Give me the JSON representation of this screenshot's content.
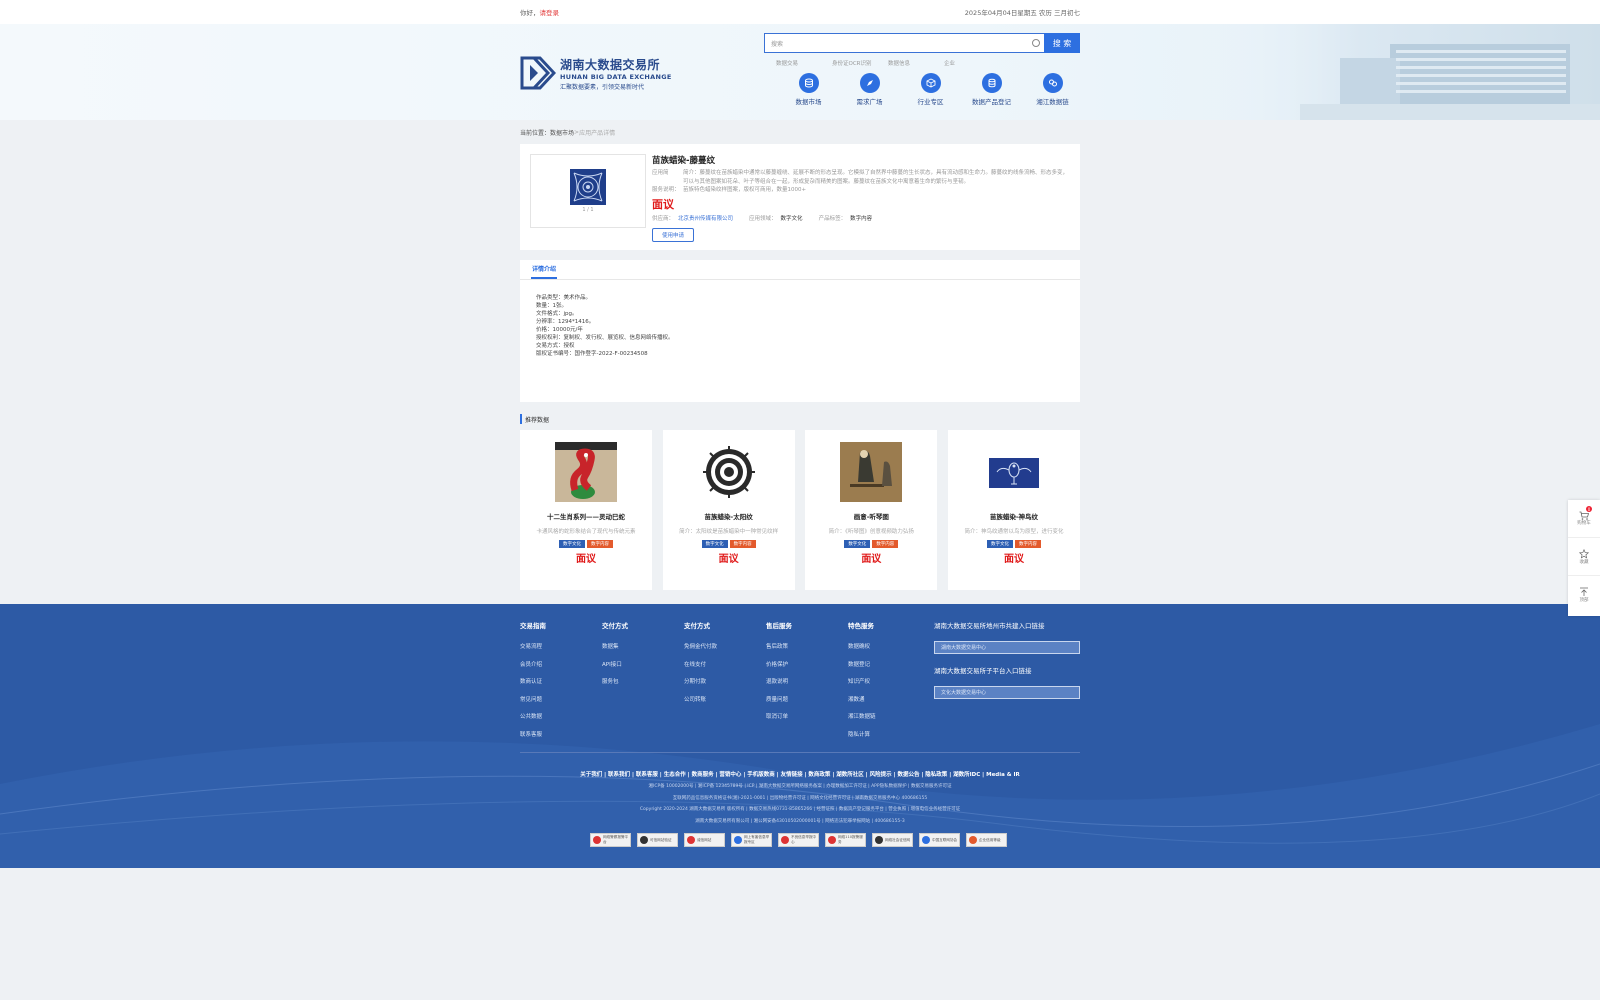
{
  "topbar": {
    "greeting": "你好，",
    "login": "请登录",
    "date": "2025年04月04日星期五 农历 三月初七"
  },
  "logo": {
    "cn": "湖南大数据交易所",
    "en": "HUNAN BIG DATA EXCHANGE",
    "slogan": "汇聚数据要素，引领交易新时代"
  },
  "search": {
    "placeholder": "搜索",
    "button": "搜 索"
  },
  "hotlinks": [
    "数据交易",
    "身份证OCR识别",
    "数据信息",
    "企业"
  ],
  "nav": [
    {
      "label": "数据市场",
      "icon": "database-icon"
    },
    {
      "label": "需求广场",
      "icon": "compass-icon"
    },
    {
      "label": "行业专区",
      "icon": "cube-icon"
    },
    {
      "label": "数据产品登记",
      "icon": "register-icon"
    },
    {
      "label": "湘江数据链",
      "icon": "chain-icon"
    }
  ],
  "breadcrumb": {
    "prefix": "当前位置：",
    "market": "数据市场",
    "sep": " > ",
    "current": "应用产品详情"
  },
  "product": {
    "title": "苗族蜡染-藤蔓纹",
    "intro_key": "应用简",
    "intro": "简介：藤蔓纹在苗族蜡染中通常以藤蔓缠绕、延展不断的形态呈现。它模拟了自然界中藤蔓的生长状态，具有流动感和生命力。藤蔓纹的线条流畅、形态多变，可以与其他图案如花朵、叶子等组合在一起，形成复杂而精美的图案。藤蔓纹在苗族文化中寓意着生命的繁衍与坚韧。",
    "service_key": "服务说明：",
    "service": "苗族特色蜡染纹样图案，版权可商用，数量1000+",
    "price": "面议",
    "supplier_key": "供应商：",
    "supplier": "北京贵州传媒有限公司",
    "field_key": "应用领域：",
    "field": "数字文化",
    "tag_key": "产品标签：",
    "tag": "数字内容",
    "apply": "使用申请",
    "pager": "1 / 1"
  },
  "detail": {
    "tab": "详情介绍",
    "lines": [
      "作品类型：美术作品。",
      "数量：1张。",
      "文件格式：jpg。",
      "分辨率：1294*1416。",
      "价格：10000元/年",
      "授权权利：复制权、发行权、展览权、信息网络传播权。",
      "交易方式：授权",
      "版权证书编号：国作登字-2022-F-00234508"
    ]
  },
  "recommend": {
    "title": "推荐数据",
    "cards": [
      {
        "name": "十二生肖系列——灵动巳蛇",
        "desc": "卡通风格的蛇形象结合了现代与传统元素",
        "tag1": "数字文化",
        "tag2": "数字内容",
        "price": "面议"
      },
      {
        "name": "苗族蜡染-太阳纹",
        "desc": "简介：太阳纹是苗族蜡染中一种常见纹样",
        "tag1": "数字文化",
        "tag2": "数字内容",
        "price": "面议"
      },
      {
        "name": "画意-听琴图",
        "desc": "简介：《听琴图》创意视频助力弘扬",
        "tag1": "数字文化",
        "tag2": "数字内容",
        "price": "面议"
      },
      {
        "name": "苗族蜡染-神鸟纹",
        "desc": "简介：神鸟纹通常以鸟为原型，进行变化",
        "tag1": "数字文化",
        "tag2": "数字内容",
        "price": "面议"
      }
    ]
  },
  "footer": {
    "cols": [
      {
        "title": "交易指南",
        "items": [
          "交易流程",
          "会员介绍",
          "数商认证",
          "常见问题",
          "公共数据",
          "联系客服"
        ]
      },
      {
        "title": "交付方式",
        "items": [
          "数据集",
          "API接口",
          "服务包"
        ]
      },
      {
        "title": "支付方式",
        "items": [
          "免佣金代付款",
          "在线支付",
          "分期付款",
          "公司转账"
        ]
      },
      {
        "title": "售后服务",
        "items": [
          "售后政策",
          "价格保护",
          "退款说明",
          "质量问题",
          "取消订单"
        ]
      },
      {
        "title": "特色服务",
        "items": [
          "数据确权",
          "数据登记",
          "知识产权",
          "湘数通",
          "湘江数据链",
          "隐私计算"
        ]
      }
    ],
    "right_title1": "湖南大数据交易所地州市共建入口链接",
    "right_select1": "湖南大数据交易中心",
    "right_title2": "湖南大数据交易所子平台入口链接",
    "right_select2": "文化大数据交易中心",
    "links": "关于我们 | 联系我们 | 联系客服 | 生态合作 | 数商服务 | 营销中心 | 手机版数商 | 友情链接 | 数商政策 | 湖数所社区 | 风险提示 | 数据公告 | 隐私政策 | 湖数所IDC | Media & IR",
    "legal": [
      "湘ICP备 10002000号 | 湘ICP备 12345789号 | ICP | 湖南大数据交易所网络服务备案 | 办理数据加工许可证 | APP隐私数据保护 | 数据交易服务许可证",
      "互联网药品信息服务资格证书(湘)-2021-0001 | 出版物经营许可证 | 网络文化经营许可证 | 湖南数据交易服务中心 400686155",
      "Copyright 2020-2024 湖南大数据交易所 版权所有 | 数据交易热线0731-85865266 | 经营证照 | 数据资产登记服务平台 | 营业执照 | 增值电信业务经营许可证",
      "湖南大数据交易所有限公司 | 湘公网安备43010502000001号 | 网络违法犯罪举报网站 | 400686155-3"
    ],
    "badges": [
      "网络警察报警平台",
      "可信网站验证",
      "诚信网站",
      "网上有害信息举报专区",
      "不良信息举报中心",
      "网络110报警服务",
      "网络社会征信网",
      "中国互联网协会",
      "企业信用等级"
    ]
  },
  "side": {
    "cart": "购物车",
    "cart_count": "0",
    "collect": "收藏",
    "top": "顶部"
  },
  "colors": {
    "primary": "#2d6fe0",
    "footer": "#2d5aa5",
    "price": "#e01a1a"
  }
}
